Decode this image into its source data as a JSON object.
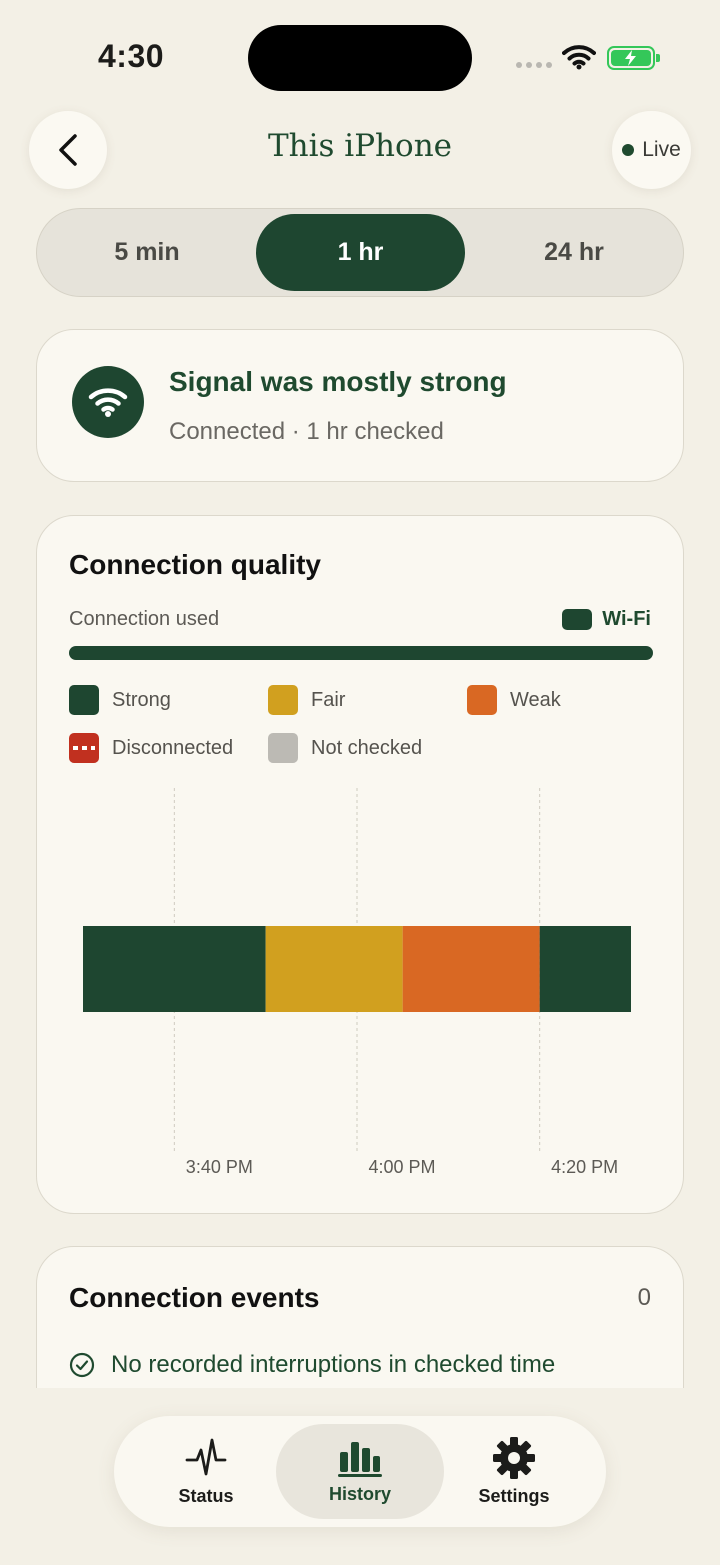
{
  "status_bar": {
    "time": "4:30"
  },
  "header": {
    "title": "This iPhone",
    "live_label": "Live"
  },
  "range_selector": {
    "options": [
      "5 min",
      "1 hr",
      "24 hr"
    ],
    "selected": "1 hr"
  },
  "summary": {
    "title": "Signal was mostly strong",
    "subtitle": "Connected · 1 hr checked"
  },
  "quality": {
    "title": "Connection quality",
    "connection_used_label": "Connection used",
    "network_label": "Wi-Fi",
    "legend": [
      {
        "label": "Strong",
        "color": "#1e4630"
      },
      {
        "label": "Fair",
        "color": "#d1a01f"
      },
      {
        "label": "Weak",
        "color": "#d96823"
      },
      {
        "label": "Disconnected",
        "color": "#c1301f"
      },
      {
        "label": "Not checked",
        "color": "#bcbab4"
      }
    ]
  },
  "chart_data": {
    "type": "bar",
    "orientation": "horizontal timeline",
    "title": "",
    "x_ticks": [
      "3:40 PM",
      "4:00 PM",
      "4:20 PM"
    ],
    "segments": [
      {
        "state": "Strong",
        "start": "3:30 PM",
        "end": "3:50 PM",
        "color": "#1e4630"
      },
      {
        "state": "Fair",
        "start": "3:50 PM",
        "end": "4:05 PM",
        "color": "#d1a01f"
      },
      {
        "state": "Weak",
        "start": "4:05 PM",
        "end": "4:20 PM",
        "color": "#d96823"
      },
      {
        "state": "Strong",
        "start": "4:20 PM",
        "end": "4:30 PM",
        "color": "#1e4630"
      }
    ],
    "grid": true
  },
  "events": {
    "title": "Connection events",
    "count": "0",
    "message": "No recorded interruptions in checked time"
  },
  "tabbar": {
    "items": [
      {
        "label": "Status",
        "icon": "pulse-icon"
      },
      {
        "label": "History",
        "icon": "bar-chart-icon"
      },
      {
        "label": "Settings",
        "icon": "gear-icon"
      }
    ],
    "selected": "History"
  }
}
